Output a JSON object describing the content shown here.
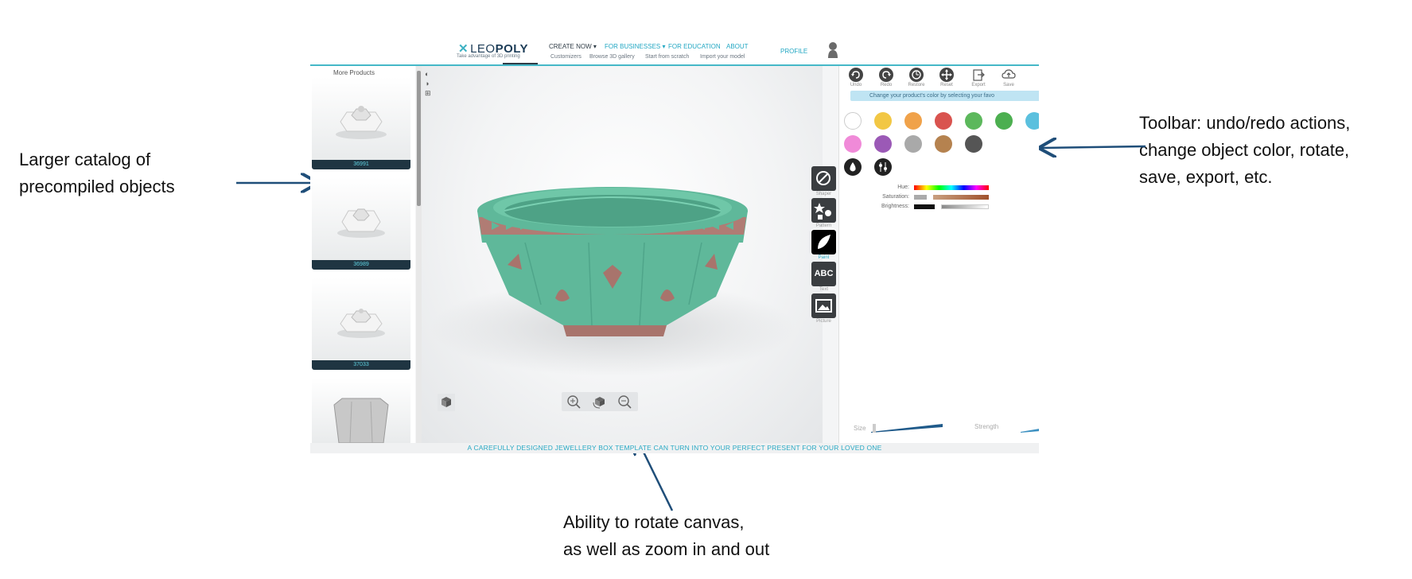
{
  "annotations": {
    "left_callout": [
      "Larger catalog of",
      "precompiled objects"
    ],
    "right_callout": [
      "Toolbar: undo/redo actions,",
      "change object color, rotate,",
      "save, export, etc."
    ],
    "bottom_callout": [
      "Ability to rotate canvas,",
      "as well as zoom in and out"
    ]
  },
  "header": {
    "logo_pre": "LEO",
    "logo_bold": "POLY",
    "logo_tagline": "Take advantage of 3D printing",
    "nav": [
      {
        "label": "CREATE NOW ▾"
      },
      {
        "label": "FOR BUSINESSES ▾"
      },
      {
        "label": "FOR EDUCATION"
      },
      {
        "label": "ABOUT"
      }
    ],
    "subnav": [
      "Customizers",
      "Browse 3D gallery",
      "Start from scratch",
      "Import your model"
    ],
    "profile": "PROFILE"
  },
  "catalog": {
    "title": "More Products",
    "items": [
      {
        "id": "36991"
      },
      {
        "id": "36989"
      },
      {
        "id": "37033"
      },
      {
        "id": ""
      }
    ]
  },
  "toolbar": {
    "buttons": [
      {
        "label": "Undo",
        "icon": "undo-icon"
      },
      {
        "label": "Redo",
        "icon": "redo-icon"
      },
      {
        "label": "Restore",
        "icon": "restore-icon"
      },
      {
        "label": "Reset",
        "icon": "reset-icon"
      },
      {
        "label": "Export",
        "icon": "export-icon"
      },
      {
        "label": "Save",
        "icon": "cloud-save-icon"
      }
    ],
    "hint": "Change your product's color by selecting your favo"
  },
  "colors": {
    "swatches": [
      "#ffffff",
      "#f2c744",
      "#f0a24a",
      "#d9534f",
      "#5cb85c",
      "#4caf50",
      "#5bc0de",
      "#f08ad8",
      "#9b59b6",
      "#a9a9a9",
      "#b5824f",
      "#555555"
    ],
    "object_body": "#5fb89a",
    "object_band": "#b07c74",
    "accent": "#29a9c4"
  },
  "color_sliders": {
    "hue": "Hue:",
    "saturation": "Saturation:",
    "brightness": "Brightness:"
  },
  "brush": {
    "size": "Size",
    "strength": "Strength"
  },
  "side_tools": [
    {
      "label": "Shaper",
      "icon": "shaper-icon"
    },
    {
      "label": "Pattern",
      "icon": "pattern-icon"
    },
    {
      "label": "Paint",
      "icon": "paint-icon"
    },
    {
      "label": "Text",
      "icon": "text-icon",
      "glyph": "ABC"
    },
    {
      "label": "Picture",
      "icon": "picture-icon"
    }
  ],
  "banner": "A CAREFULLY DESIGNED JEWELLERY BOX TEMPLATE CAN TURN INTO YOUR PERFECT PRESENT FOR YOUR LOVED ONE"
}
